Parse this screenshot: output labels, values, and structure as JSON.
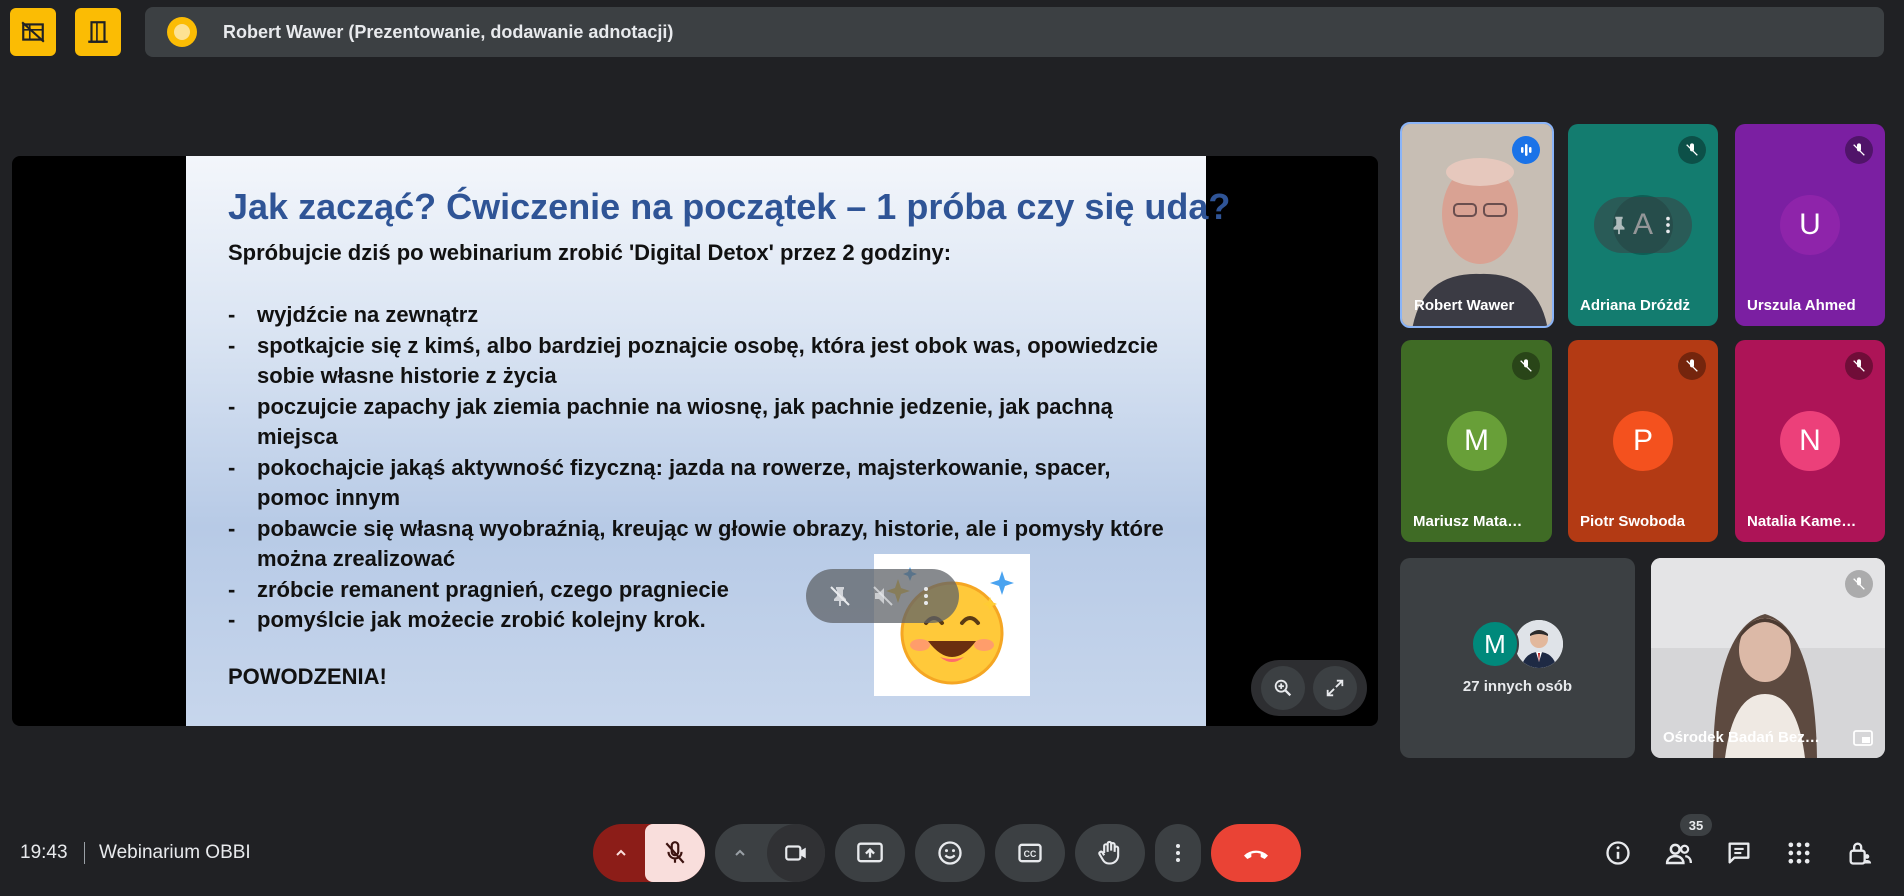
{
  "presenting": {
    "text": "Robert Wawer (Prezentowanie, dodawanie adnotacji)"
  },
  "slide": {
    "title": "Jak zacząć? Ćwiczenie na początek – 1 próba czy się uda?",
    "subtitle": "Spróbujcie dziś po webinarium zrobić 'Digital Detox' przez 2 godziny:",
    "items": [
      "wyjdźcie na zewnątrz",
      "spotkajcie się z kimś, albo bardziej poznajcie osobę, która jest obok was, opowiedzcie sobie własne historie z życia",
      "poczujcie zapachy jak ziemia pachnie na wiosnę, jak pachnie jedzenie, jak pachną miejsca",
      "pokochajcie jakąś aktywność fizyczną: jazda na rowerze, majsterkowanie, spacer, pomoc innym",
      "pobawcie się własną wyobraźnią, kreując w głowie obrazy, historie, ale i pomysły które można zrealizować",
      "zróbcie remanent pragnień, czego pragniecie",
      "pomyślcie jak możecie zrobić kolejny krok."
    ],
    "final": "POWODZENIA!"
  },
  "participants": {
    "tiles": [
      {
        "name": "Robert Wawer",
        "state": "speaking"
      },
      {
        "name": "Adriana Dróżdż",
        "initial": "A",
        "muted": true,
        "color": "#137c6f"
      },
      {
        "name": "Urszula Ahmed",
        "initial": "U",
        "muted": true,
        "color": "#8e24aa"
      },
      {
        "name": "Mariusz Mata…",
        "initial": "M",
        "muted": true,
        "color": "#4d7b2b"
      },
      {
        "name": "Piotr Swoboda",
        "initial": "P",
        "muted": true,
        "color": "#c2410c"
      },
      {
        "name": "Natalia Kame…",
        "initial": "N",
        "muted": true,
        "color": "#c2185b"
      },
      {
        "name": "Ośrodek Badań Bez…",
        "muted": true
      }
    ],
    "others": {
      "initial": "M",
      "label": "27 innych osób"
    }
  },
  "bottom": {
    "time": "19:43",
    "meeting_title": "Webinarium OBBI",
    "participant_count": "35"
  },
  "colors": {
    "background": "#202124",
    "accent_yellow": "#fbbc04",
    "end_call": "#ea4335",
    "mic_off": "#f9dedc"
  }
}
